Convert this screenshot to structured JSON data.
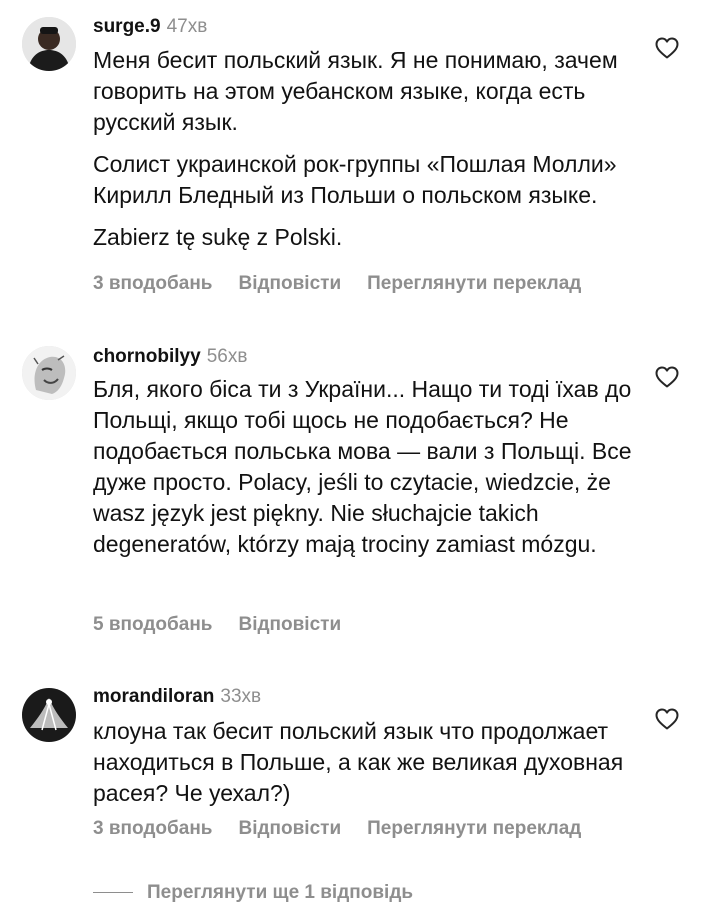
{
  "comments": [
    {
      "username": "surge.9",
      "time": "47хв",
      "paragraphs": [
        "Меня бесит польский язык. Я не понимаю, зачем говорить на этом уебанском языке, когда есть русский язык.",
        "Солист украинской рок-группы «Пошлая Молли» Кирилл Бледный из Польши о польском языке.",
        "Zabierz tę sukę z Polski."
      ],
      "likes": "3 вподобань",
      "reply": "Відповісти",
      "translate": "Переглянути переклад",
      "heart_icon": "heart-outline-icon"
    },
    {
      "username": "chornobilyy",
      "time": "56хв",
      "paragraphs": [
        "Бля, якого біса ти з України... Нащо ти тоді їхав до Польщі, якщо тобі щось не подобається? Не подобається польська мова — вали з Польщі. Все дуже просто. Polacy, jeśli to czytacie, wiedzcie, że wasz język jest piękny.  Nie słuchajcie takich degeneratów, którzy mają trociny zamiast mózgu."
      ],
      "likes": "5 вподобань",
      "reply": "Відповісти",
      "heart_icon": "heart-outline-icon"
    },
    {
      "username": "morandiloran",
      "time": "33хв",
      "paragraphs": [
        "клоуна так бесит польский язык что продолжает находиться в Польше, а как же великая духовная расея? Че уехал?)"
      ],
      "likes": "3 вподобань",
      "reply": "Відповісти",
      "translate": "Переглянути переклад",
      "heart_icon": "heart-outline-icon"
    }
  ],
  "more_replies": "Переглянути ще 1 відповідь",
  "colors": {
    "text": "#121212",
    "secondary": "#8e8e8e",
    "background": "#ffffff"
  }
}
